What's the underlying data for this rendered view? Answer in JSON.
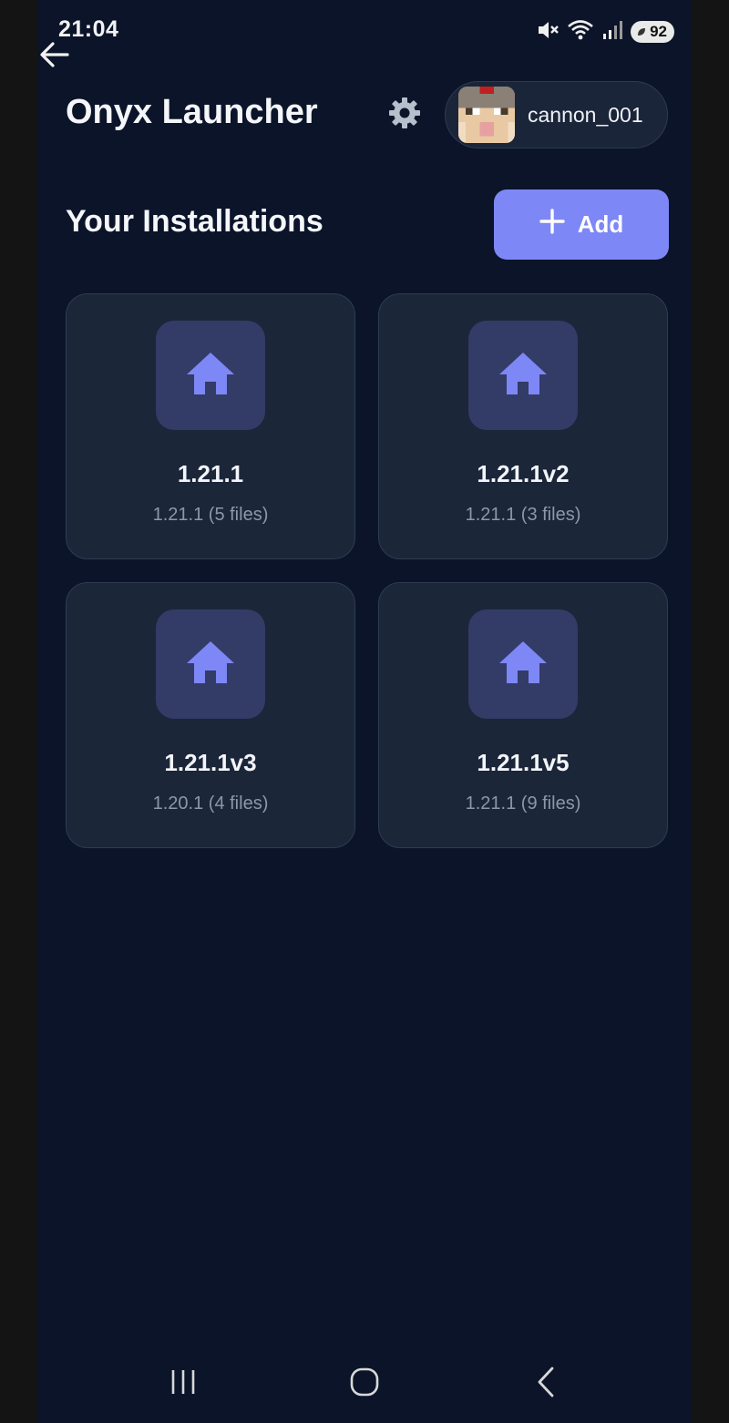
{
  "status_bar": {
    "time": "21:04",
    "battery": "92",
    "icons": [
      "mute-icon",
      "wifi-icon",
      "signal-icon",
      "battery-icon"
    ]
  },
  "header": {
    "title": "Onyx Launcher",
    "profile": {
      "username": "cannon_001"
    }
  },
  "section": {
    "title": "Your Installations",
    "add_label": "Add"
  },
  "installations": [
    {
      "name": "1.21.1",
      "detail": "1.21.1 (5 files)",
      "icon": "home-icon"
    },
    {
      "name": "1.21.1v2",
      "detail": "1.21.1 (3 files)",
      "icon": "home-icon"
    },
    {
      "name": "1.21.1v3",
      "detail": "1.20.1 (4 files)",
      "icon": "home-icon"
    },
    {
      "name": "1.21.1v5",
      "detail": "1.21.1 (9 files)",
      "icon": "home-icon"
    }
  ],
  "colors": {
    "background": "#0b1429",
    "card": "#1b2639",
    "accent": "#7d87f5",
    "icon_tile": "#333b67"
  }
}
